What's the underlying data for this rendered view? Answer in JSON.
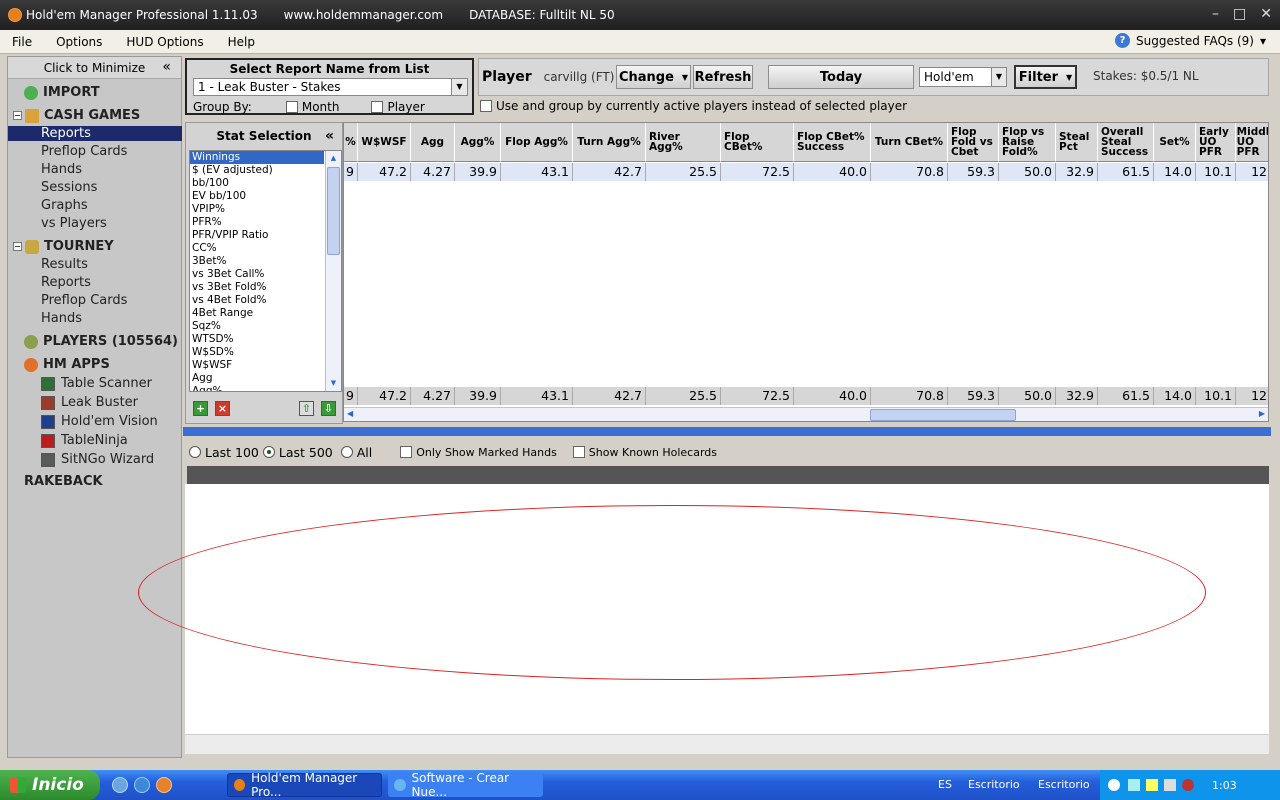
{
  "window": {
    "title": "Hold'em Manager Professional 1.11.03",
    "url": "www.holdemmanager.com",
    "database": "DATABASE: Fulltilt NL 50"
  },
  "menu": {
    "items": [
      "File",
      "Options",
      "HUD Options",
      "Help"
    ],
    "faq": "Suggested FAQs (9)"
  },
  "sidebar": {
    "minimize": "Click to Minimize",
    "import": "IMPORT",
    "cash_games": "CASH GAMES",
    "cash_items": [
      "Reports",
      "Preflop Cards",
      "Hands",
      "Sessions",
      "Graphs",
      "vs Players"
    ],
    "tourney": "TOURNEY",
    "tourney_items": [
      "Results",
      "Reports",
      "Preflop Cards",
      "Hands"
    ],
    "players": "PLAYERS (105564)",
    "hm_apps": "HM APPS",
    "apps": [
      "Table Scanner",
      "Leak Buster",
      "Hold'em Vision",
      "TableNinja",
      "SitNGo Wizard"
    ],
    "rakeback": "RAKEBACK"
  },
  "report": {
    "header": "Select Report Name from List",
    "selected": "1 - Leak Buster - Stakes",
    "group_by": "Group By:",
    "month": "Month",
    "player": "Player"
  },
  "playerbar": {
    "label": "Player",
    "name": "carvillg (FT)",
    "change": "Change",
    "refresh": "Refresh",
    "today": "Today",
    "game": "Hold'em",
    "filter": "Filter",
    "stakes": "Stakes: $0.5/1 NL",
    "active_players": "Use and group by currently active players instead of selected player"
  },
  "stats": {
    "header": "Stat Selection",
    "items": [
      "Winnings",
      "$ (EV adjusted)",
      "bb/100",
      "EV bb/100",
      "VPIP%",
      "PFR%",
      "PFR/VPIP Ratio",
      "CC%",
      "3Bet%",
      "vs 3Bet Call%",
      "vs 3Bet Fold%",
      "vs 4Bet Fold%",
      "4Bet Range",
      "Sqz%",
      "WTSD%",
      "W$SD%",
      "W$WSF",
      "Agg",
      "Agg%"
    ]
  },
  "grid": {
    "headers": [
      "%",
      "W$WSF",
      "Agg",
      "Agg%",
      "Flop Agg%",
      "Turn Agg%",
      "River Agg%",
      "Flop CBet%",
      "Flop CBet% Success",
      "Turn CBet%",
      "Flop Fold vs Cbet",
      "Flop vs Raise Fold%",
      "Steal Pct",
      "Overall Steal Success",
      "Set%",
      "Early UO PFR",
      "Middl UO PFR"
    ],
    "row": [
      "9",
      "47.2",
      "4.27",
      "39.9",
      "43.1",
      "42.7",
      "25.5",
      "72.5",
      "40.0",
      "70.8",
      "59.3",
      "50.0",
      "32.9",
      "61.5",
      "14.0",
      "10.1",
      "12"
    ],
    "total": [
      "9",
      "47.2",
      "4.27",
      "39.9",
      "43.1",
      "42.7",
      "25.5",
      "72.5",
      "40.0",
      "70.8",
      "59.3",
      "50.0",
      "32.9",
      "61.5",
      "14.0",
      "10.1",
      "12"
    ]
  },
  "bottom": {
    "last100": "Last 100",
    "last500": "Last 500",
    "all": "All",
    "marked": "Only Show Marked Hands",
    "holecards": "Show Known Holecards"
  },
  "taskbar": {
    "start": "Inicio",
    "task1": "Hold'em Manager Pro...",
    "task2": "Software - Crear Nue...",
    "lang": "ES",
    "desk1": "Escritorio",
    "desk2": "Escritorio",
    "time": "1:03"
  },
  "colors": {
    "nav_selected": "#1c2a6c",
    "splitter": "#3c6fd3",
    "ellipse": "#dd2222"
  }
}
